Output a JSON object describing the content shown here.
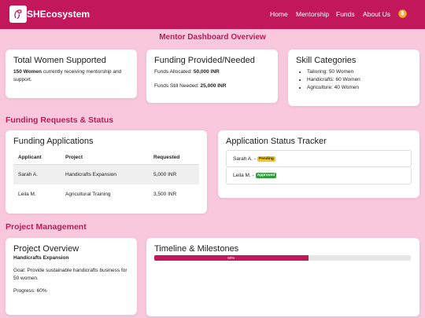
{
  "nav": {
    "brand": "SHEcosystem",
    "links": [
      "Home",
      "Mentorship",
      "Funds",
      "About Us"
    ],
    "coin_symbol": "$"
  },
  "page_title": "Mentor Dashboard Overview",
  "summary": {
    "women": {
      "title": "Total Women Supported",
      "count": "150 Women",
      "desc": " currently receiving mentorship and support."
    },
    "funding": {
      "title": "Funding Provided/Needed",
      "allocated_label": "Funds Allocated: ",
      "allocated_value": "50,000 INR",
      "needed_label": "Funds Still Needed: ",
      "needed_value": "25,000 INR"
    },
    "skills": {
      "title": "Skill Categories",
      "items": [
        "Tailoring: 50 Women",
        "Handicrafts: 60 Women",
        "Agriculture: 40 Women"
      ]
    }
  },
  "funding_section": {
    "title": "Funding Requests & Status",
    "applications": {
      "title": "Funding Applications",
      "headers": [
        "Applicant",
        "Project",
        "Requested"
      ],
      "rows": [
        [
          "Sarah A.",
          "Handicrafts Expansion",
          "5,000 INR"
        ],
        [
          "Leila M.",
          "Agricultural Training",
          "3,500 INR"
        ]
      ]
    },
    "tracker": {
      "title": "Application Status Tracker",
      "items": [
        {
          "name": "Sarah A. - ",
          "status": "Pending"
        },
        {
          "name": "Leila M. - ",
          "status": "Approved"
        }
      ]
    }
  },
  "project_section": {
    "title": "Project Management",
    "overview": {
      "title": "Project Overview",
      "project_name": "Handicrafts Expansion",
      "goal": "Goal: Provide sustainable handicrafts business for 50 women.",
      "progress": "Progress: 60%"
    },
    "timeline": {
      "title": "Timeline & Milestones",
      "progress_label": "60%",
      "progress_fraction": 0.6
    }
  },
  "colors": {
    "primary": "#c2185b",
    "background": "#f9c8dc",
    "pending": "#f5c518",
    "approved": "#2e9d3a"
  }
}
